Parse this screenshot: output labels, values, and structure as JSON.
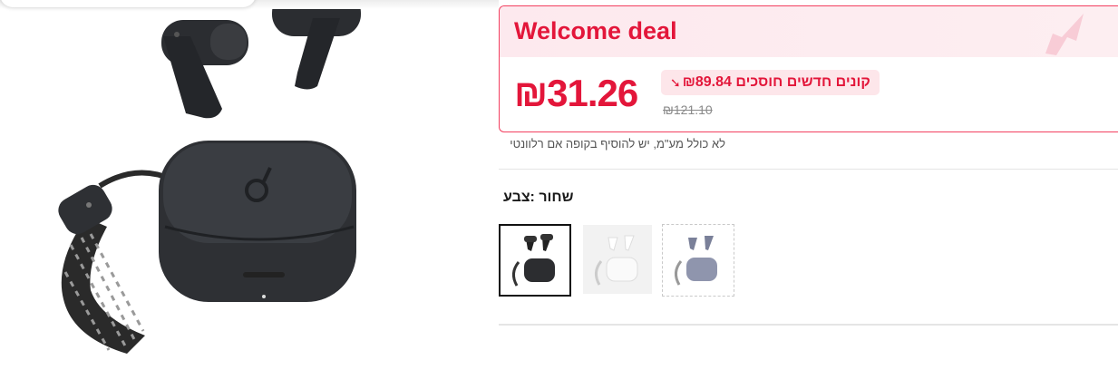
{
  "deal": {
    "title": "Welcome deal",
    "price": "₪31.26",
    "savings": "קונים חדשים חוסכים ₪89.84",
    "original_price": "₪121.10"
  },
  "vat_note": "לא כולל מע\"מ, יש להוסיף בקופה אם רלוונטי",
  "color": {
    "label": "שחור :צבע",
    "options": [
      "black-earbuds-thumbnail",
      "white-earbuds-thumbnail",
      "blue-earbuds-thumbnail"
    ],
    "selected": 0
  },
  "colors": {
    "accent": "#e3163a",
    "deal_border": "#f23f5f",
    "deal_header_bg": "#fde9ee"
  }
}
